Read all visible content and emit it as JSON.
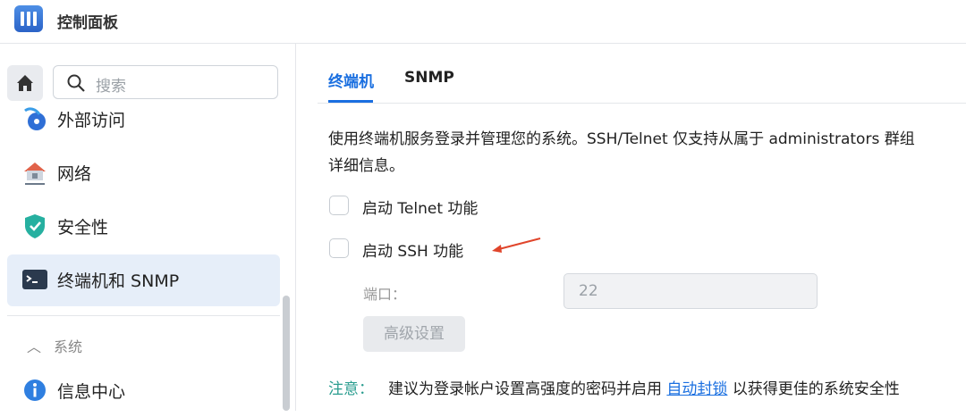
{
  "app": {
    "title": "控制面板"
  },
  "sidebar": {
    "search_placeholder": "搜索",
    "items": [
      {
        "label": "外部访问",
        "icon": "external-access-icon"
      },
      {
        "label": "网络",
        "icon": "network-icon"
      },
      {
        "label": "安全性",
        "icon": "shield-icon"
      },
      {
        "label": "终端机和 SNMP",
        "icon": "terminal-icon",
        "active": true
      }
    ],
    "section": {
      "label": "系统",
      "expanded": true
    },
    "section_items": [
      {
        "label": "信息中心",
        "icon": "info-icon"
      }
    ]
  },
  "tabs": [
    {
      "label": "终端机",
      "active": true
    },
    {
      "label": "SNMP"
    }
  ],
  "content": {
    "description_line1": "使用终端机服务登录并管理您的系统。SSH/Telnet 仅支持从属于 administrators 群组",
    "description_line2": "详细信息。",
    "telnet_label": "启动 Telnet 功能",
    "ssh_label": "启动 SSH 功能",
    "port_label": "端口：",
    "port_value": "22",
    "advanced_button": "高级设置",
    "note_label": "注意：",
    "note_text_before": "建议为登录帐户设置高强度的密码并启用",
    "note_link": "自动封锁",
    "note_text_after": "以获得更佳的系统安全性"
  },
  "colors": {
    "accent": "#1a6fe0",
    "annotation_arrow": "#e0452b",
    "note": "#2a9d8f"
  }
}
